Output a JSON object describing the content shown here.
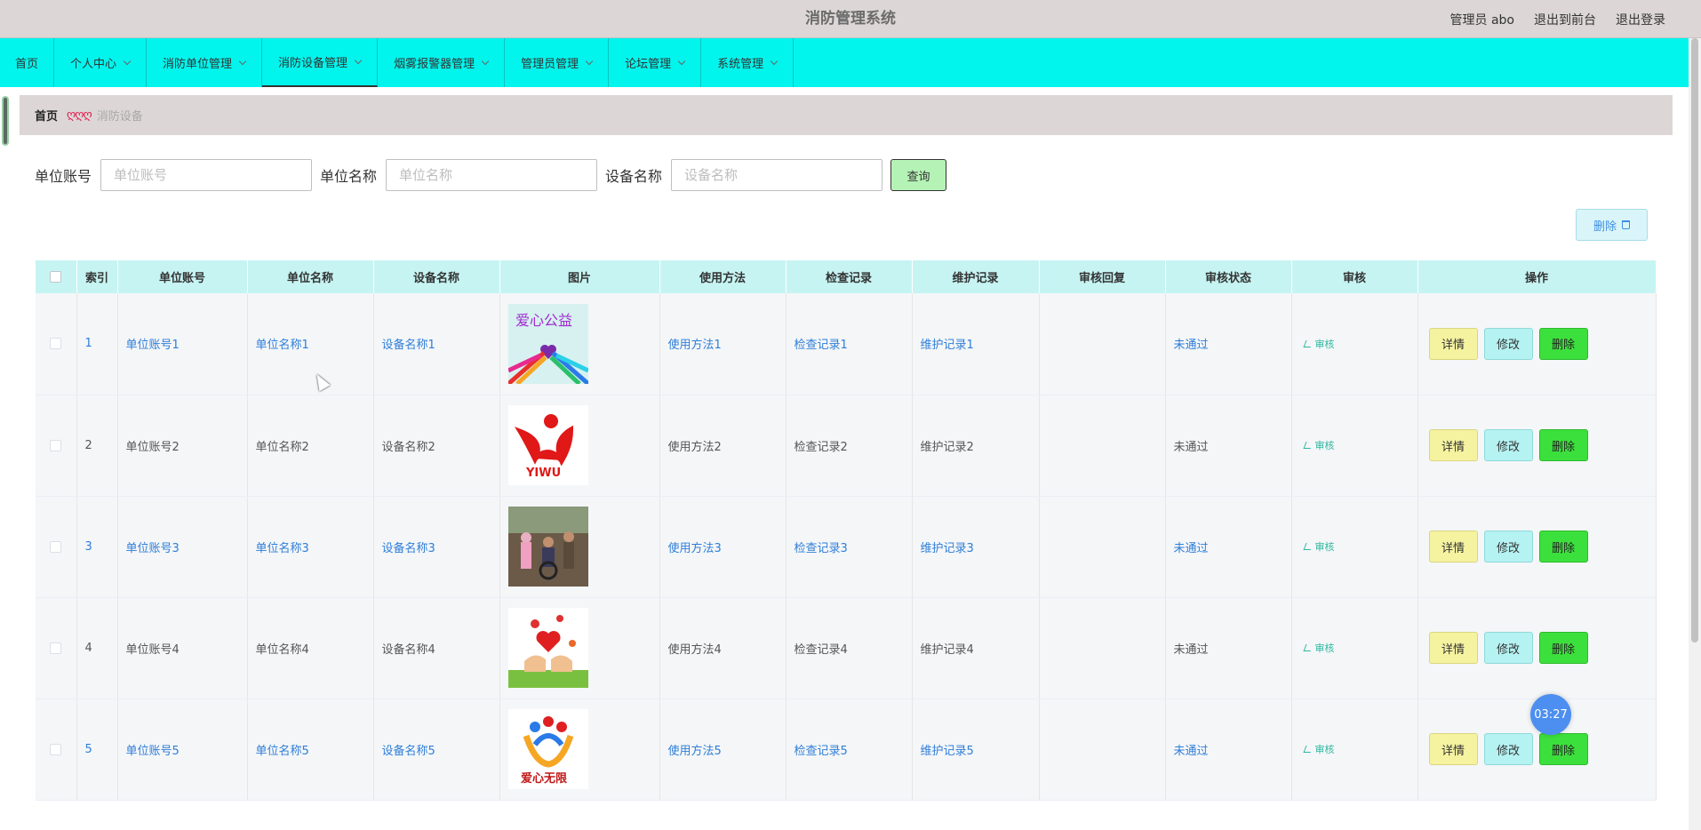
{
  "app": {
    "title": "消防管理系统"
  },
  "top_links": [
    "管理员 abo",
    "退出到前台",
    "退出登录"
  ],
  "nav": [
    {
      "label": "首页",
      "dropdown": false,
      "active": false
    },
    {
      "label": "个人中心",
      "dropdown": true,
      "active": false
    },
    {
      "label": "消防单位管理",
      "dropdown": true,
      "active": false
    },
    {
      "label": "消防设备管理",
      "dropdown": true,
      "active": true
    },
    {
      "label": "烟雾报警器管理",
      "dropdown": true,
      "active": false
    },
    {
      "label": "管理员管理",
      "dropdown": true,
      "active": false
    },
    {
      "label": "论坛管理",
      "dropdown": true,
      "active": false
    },
    {
      "label": "系统管理",
      "dropdown": true,
      "active": false
    }
  ],
  "breadcrumb": {
    "home": "首页",
    "separator": "ღღღ",
    "current": "消防设备"
  },
  "search": {
    "fields": [
      {
        "label": "单位账号",
        "placeholder": "单位账号",
        "value": ""
      },
      {
        "label": "单位名称",
        "placeholder": "单位名称",
        "value": ""
      },
      {
        "label": "设备名称",
        "placeholder": "设备名称",
        "value": ""
      }
    ],
    "query_label": "查询"
  },
  "batch_delete_label": "删除",
  "table": {
    "columns": [
      "索引",
      "单位账号",
      "单位名称",
      "设备名称",
      "图片",
      "使用方法",
      "检查记录",
      "维护记录",
      "审核回复",
      "审核状态",
      "审核",
      "操作"
    ],
    "rows": [
      {
        "index": "1",
        "account": "单位账号1",
        "unit": "单位名称1",
        "device": "设备名称1",
        "usage": "使用方法1",
        "check": "检查记录1",
        "maintain": "维护记录1",
        "reply": "",
        "status": "未通过",
        "audit": "审核",
        "image": "love-charity-poster",
        "linked": true
      },
      {
        "index": "2",
        "account": "单位账号2",
        "unit": "单位名称2",
        "device": "设备名称2",
        "usage": "使用方法2",
        "check": "检查记录2",
        "maintain": "维护记录2",
        "reply": "",
        "status": "未通过",
        "audit": "审核",
        "image": "yiwu-logo",
        "linked": false
      },
      {
        "index": "3",
        "account": "单位账号3",
        "unit": "单位名称3",
        "device": "设备名称3",
        "usage": "使用方法3",
        "check": "检查记录3",
        "maintain": "维护记录3",
        "reply": "",
        "status": "未通过",
        "audit": "审核",
        "image": "street-photo",
        "linked": true
      },
      {
        "index": "4",
        "account": "单位账号4",
        "unit": "单位名称4",
        "device": "设备名称4",
        "usage": "使用方法4",
        "check": "检查记录4",
        "maintain": "维护记录4",
        "reply": "",
        "status": "未通过",
        "audit": "审核",
        "image": "hands-hearts",
        "linked": false
      },
      {
        "index": "5",
        "account": "单位账号5",
        "unit": "单位名称5",
        "device": "设备名称5",
        "usage": "使用方法5",
        "check": "检查记录5",
        "maintain": "维护记录5",
        "reply": "",
        "status": "未通过",
        "audit": "审核",
        "image": "love-unlimited-logo",
        "linked": true
      }
    ],
    "actions": {
      "detail": "详情",
      "edit": "修改",
      "delete": "删除"
    }
  },
  "timer": "03:27",
  "colors": {
    "nav_bg": "#02f5ed",
    "header_bg": "#dcd6d6",
    "table_header": "#c6f4f3",
    "link": "#2f7ed8",
    "delete_btn": "#3ce03c",
    "detail_btn": "#f5f2a0",
    "edit_btn": "#b5f2f2"
  }
}
